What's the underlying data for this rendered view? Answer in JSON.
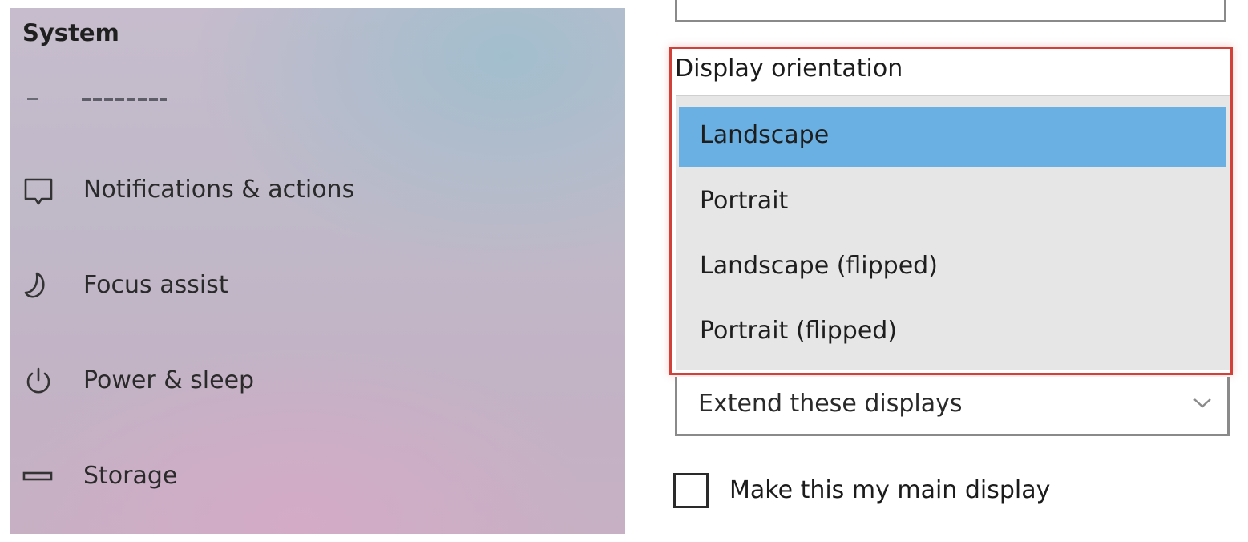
{
  "nav": {
    "title": "System",
    "items": [
      {
        "label": "Notifications & actions",
        "icon": "notifications-icon"
      },
      {
        "label": "Focus assist",
        "icon": "moon-icon"
      },
      {
        "label": "Power & sleep",
        "icon": "power-icon"
      },
      {
        "label": "Storage",
        "icon": "storage-icon"
      }
    ]
  },
  "display": {
    "orientation_label": "Display orientation",
    "orientation_options": [
      {
        "label": "Landscape",
        "selected": true
      },
      {
        "label": "Portrait",
        "selected": false
      },
      {
        "label": "Landscape (flipped)",
        "selected": false
      },
      {
        "label": "Portrait (flipped)",
        "selected": false
      }
    ],
    "multiple_displays_value": "Extend these displays",
    "main_display_checkbox": {
      "label": "Make this my main display",
      "checked": false
    }
  },
  "colors": {
    "selection": "#6ab0e3",
    "highlight_border": "#d2403a",
    "dropdown_bg": "#e6e6e6"
  }
}
